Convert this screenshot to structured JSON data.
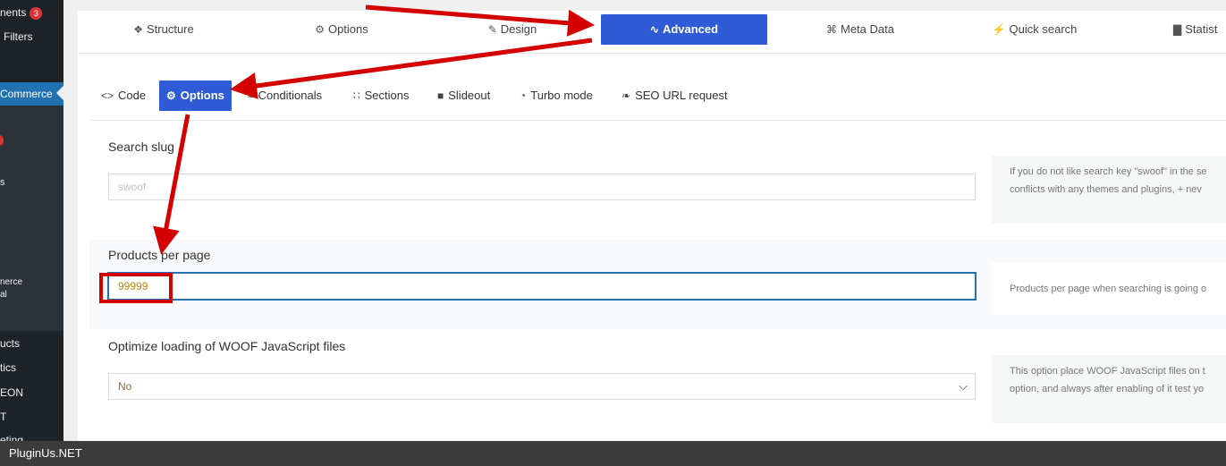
{
  "sidebar": {
    "items": [
      {
        "label": "nents",
        "badge": "3"
      },
      {
        "label": "Filters"
      },
      {
        "label": "Commerce"
      },
      {
        "label": "nerce"
      },
      {
        "label": "al"
      },
      {
        "label": "ucts"
      },
      {
        "label": "tics"
      },
      {
        "label": "EON"
      },
      {
        "label": "T"
      },
      {
        "label": "eting"
      }
    ],
    "stray_glyph": "s"
  },
  "top_tabs": [
    {
      "label": "Structure",
      "icon": "structure-icon"
    },
    {
      "label": "Options",
      "icon": "gear-icon"
    },
    {
      "label": "Design",
      "icon": "design-icon"
    },
    {
      "label": "Advanced",
      "icon": "wave-icon",
      "active": true
    },
    {
      "label": "Meta Data",
      "icon": "nodes-icon"
    },
    {
      "label": "Quick search",
      "icon": "bolt-icon"
    },
    {
      "label": "Statist",
      "icon": "chart-icon"
    }
  ],
  "sub_tabs": [
    {
      "label": "Code",
      "icon": "code-icon"
    },
    {
      "label": "Options",
      "icon": "gear-icon",
      "active": true
    },
    {
      "label": "Conditionals",
      "icon": "waves-icon"
    },
    {
      "label": "Sections",
      "icon": "grid-icon"
    },
    {
      "label": "Slideout",
      "icon": "truck-icon"
    },
    {
      "label": "Turbo mode",
      "icon": "gauge-icon"
    },
    {
      "label": "SEO URL request",
      "icon": "leaf-icon"
    }
  ],
  "fields": {
    "search_slug": {
      "label": "Search slug",
      "placeholder": "swoof",
      "help_line1": "If you do not like search key \"swoof\" in the se",
      "help_line2": "conflicts with any themes and plugins, + nev"
    },
    "products_per_page": {
      "label": "Products per page",
      "value": "99999",
      "help_line1": "Products per page when searching is going o"
    },
    "optimize_js": {
      "label": "Optimize loading of WOOF JavaScript files",
      "selected": "No",
      "help_line1": "This option place WOOF JavaScript files on t",
      "help_line2": "option, and always after enabling of it test yo"
    }
  },
  "footer": {
    "text": "PluginUs.NET"
  },
  "colors": {
    "accent": "#2f5bd6",
    "annotation": "#d40000",
    "sidebar": "#1d2327"
  }
}
